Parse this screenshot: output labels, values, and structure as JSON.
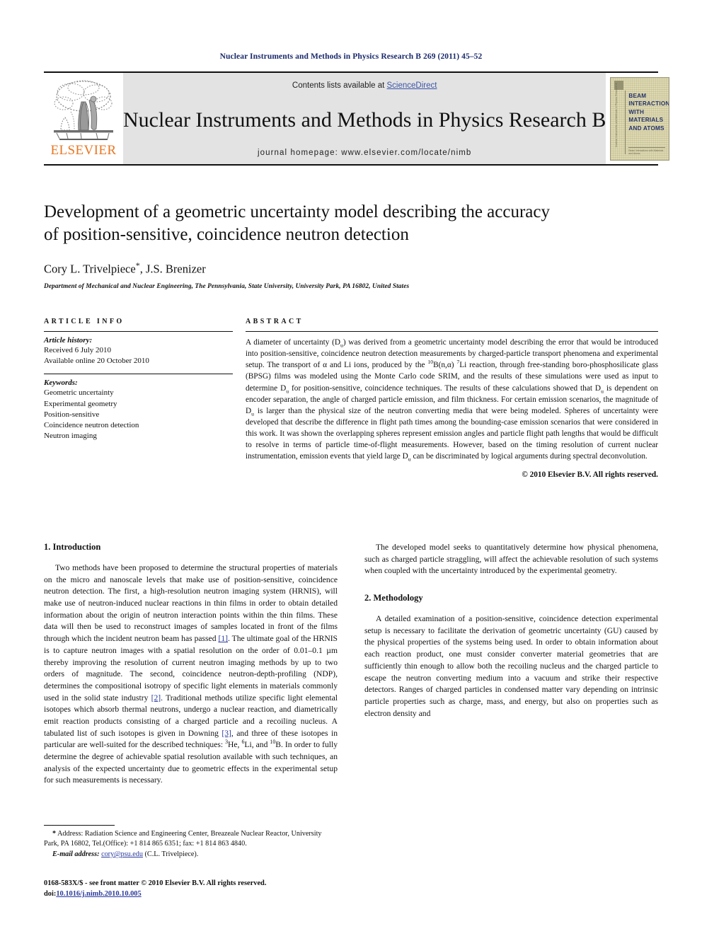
{
  "running_head": "Nuclear Instruments and Methods in Physics Research B 269 (2011) 45–52",
  "masthead": {
    "publisher_name": "ELSEVIER",
    "contents_prefix": "Contents lists available at ",
    "sciencedirect": "ScienceDirect",
    "journal_title": "Nuclear Instruments and Methods in Physics Research B",
    "homepage": "journal homepage: www.elsevier.com/locate/nimb",
    "cover_text": "BEAM\nINTERACTIONS\nWITH\nMATERIALS\nAND ATOMS",
    "cover_side": "Nuclear Instruments and Methods in Physics Research B",
    "cover_foot": "Beam Interactions with Materials and Atoms",
    "link_color": "#3b55a8",
    "brand_color": "#E87722"
  },
  "title": {
    "line1": "Development of a geometric uncertainty model describing the accuracy",
    "line2": "of position-sensitive, coincidence neutron detection",
    "authors_pre": "Cory L. Trivelpiece",
    "corresponding_mark": "*",
    "authors_post": ", J.S. Brenizer",
    "affiliation": "Department of Mechanical and Nuclear Engineering, The Pennsylvania, State University, University Park, PA 16802, United States"
  },
  "article_info": {
    "heading": "ARTICLE INFO",
    "history_label": "Article history:",
    "history": [
      "Received 6 July 2010",
      "Available online 20 October 2010"
    ],
    "keywords_label": "Keywords:",
    "keywords": [
      "Geometric uncertainty",
      "Experimental geometry",
      "Position-sensitive",
      "Coincidence neutron detection",
      "Neutron imaging"
    ]
  },
  "abstract": {
    "heading": "ABSTRACT",
    "part1": "A diameter of uncertainty (D",
    "sub1": "u",
    "part2": ") was derived from a geometric uncertainty model describing the error that would be introduced into position-sensitive, coincidence neutron detection measurements by charged-particle transport phenomena and experimental setup. The transport of α and Li ions, produced by the ",
    "sup1": "10",
    "part3": "B(n,α) ",
    "sup2": "7",
    "part4": "Li reaction, through free-standing boro-phosphosilicate glass (BPSG) films was modeled using the Monte Carlo code SRIM, and the results of these simulations were used as input to determine D",
    "sub2": "u",
    "part5": " for position-sensitive, coincidence techniques. The results of these calculations showed that D",
    "sub3": "u",
    "part6": " is dependent on encoder separation, the angle of charged particle emission, and film thickness. For certain emission scenarios, the magnitude of D",
    "sub4": "u",
    "part7": " is larger than the physical size of the neutron converting media that were being modeled. Spheres of uncertainty were developed that describe the difference in flight path times among the bounding-case emission scenarios that were considered in this work. It was shown the overlapping spheres represent emission angles and particle flight path lengths that would be difficult to resolve in terms of particle time-of-flight measurements. However, based on the timing resolution of current nuclear instrumentation, emission events that yield large D",
    "sub5": "u",
    "part8": " can be discriminated by logical arguments during spectral deconvolution.",
    "copyright": "© 2010 Elsevier B.V. All rights reserved."
  },
  "body": {
    "section1_title": "1. Introduction",
    "section1_par1_a": "Two methods have been proposed to determine the structural properties of materials on the micro and nanoscale levels that make use of position-sensitive, coincidence neutron detection. The first, a high-resolution neutron imaging system (HRNIS), will make use of neutron-induced nuclear reactions in thin films in order to obtain detailed information about the origin of neutron interaction points within the thin films. These data will then be used to reconstruct images of samples located in front of the films through which the incident neutron beam has passed ",
    "ref1": "[1]",
    "section1_par1_b": ". The ultimate goal of the HRNIS is to capture neutron images with a spatial resolution on the order of 0.01–0.1 µm thereby improving the resolution of current neutron imaging methods by up to two orders of magnitude. The second, coincidence neutron-depth-profiling (NDP), determines the compositional isotropy of specific light elements in materials commonly used in the solid state industry ",
    "ref2": "[2]",
    "section1_par1_c": ". Traditional methods utilize specific light elemental isotopes which absorb thermal neutrons, undergo a nuclear reaction, and diametrically emit reaction products consisting of a charged particle and a recoiling nucleus. A tabulated list of such isotopes is given in Downing ",
    "ref3": "[3]",
    "section1_par1_d": ", and three of these isotopes in particular are well-suited for the described techniques: ",
    "sup_he": "3",
    "iso_he": "He, ",
    "sup_li": "6",
    "iso_li": "Li, and ",
    "sup_b": "10",
    "iso_b": "B",
    "section1_par1_e": ". In order to fully determine the degree of achievable spatial resolution available with such techniques, an analysis of the expected uncertainty due to geometric effects in the experimental setup for such measurements is necessary.",
    "section1_par2": "The developed model seeks to quantitatively determine how physical phenomena, such as charged particle straggling, will affect the achievable resolution of such systems when coupled with the uncertainty introduced by the experimental geometry.",
    "section2_title": "2. Methodology",
    "section2_par1": "A detailed examination of a position-sensitive, coincidence detection experimental setup is necessary to facilitate the derivation of geometric uncertainty (GU) caused by the physical properties of the systems being used. In order to obtain information about each reaction product, one must consider converter material geometries that are sufficiently thin enough to allow both the recoiling nucleus and the charged particle to escape the neutron converting medium into a vacuum and strike their respective detectors. Ranges of charged particles in condensed matter vary depending on intrinsic particle properties such as charge, mass, and energy, but also on properties such as electron density and"
  },
  "footnotes": {
    "star": "*",
    "address_label": " Address: Radiation Science and Engineering Center, Breazeale Nuclear Reactor, University Park, PA 16802, Tel.(Office): +1 814 865 6351; fax: +1 814 863 4840.",
    "email_label": "E-mail address:",
    "email": "cory@psu.edu",
    "email_suffix": " (C.L. Trivelpiece)."
  },
  "imprint": {
    "line1": "0168-583X/$ - see front matter © 2010 Elsevier B.V. All rights reserved.",
    "doi_prefix": "doi:",
    "doi": "10.1016/j.nimb.2010.10.005"
  }
}
